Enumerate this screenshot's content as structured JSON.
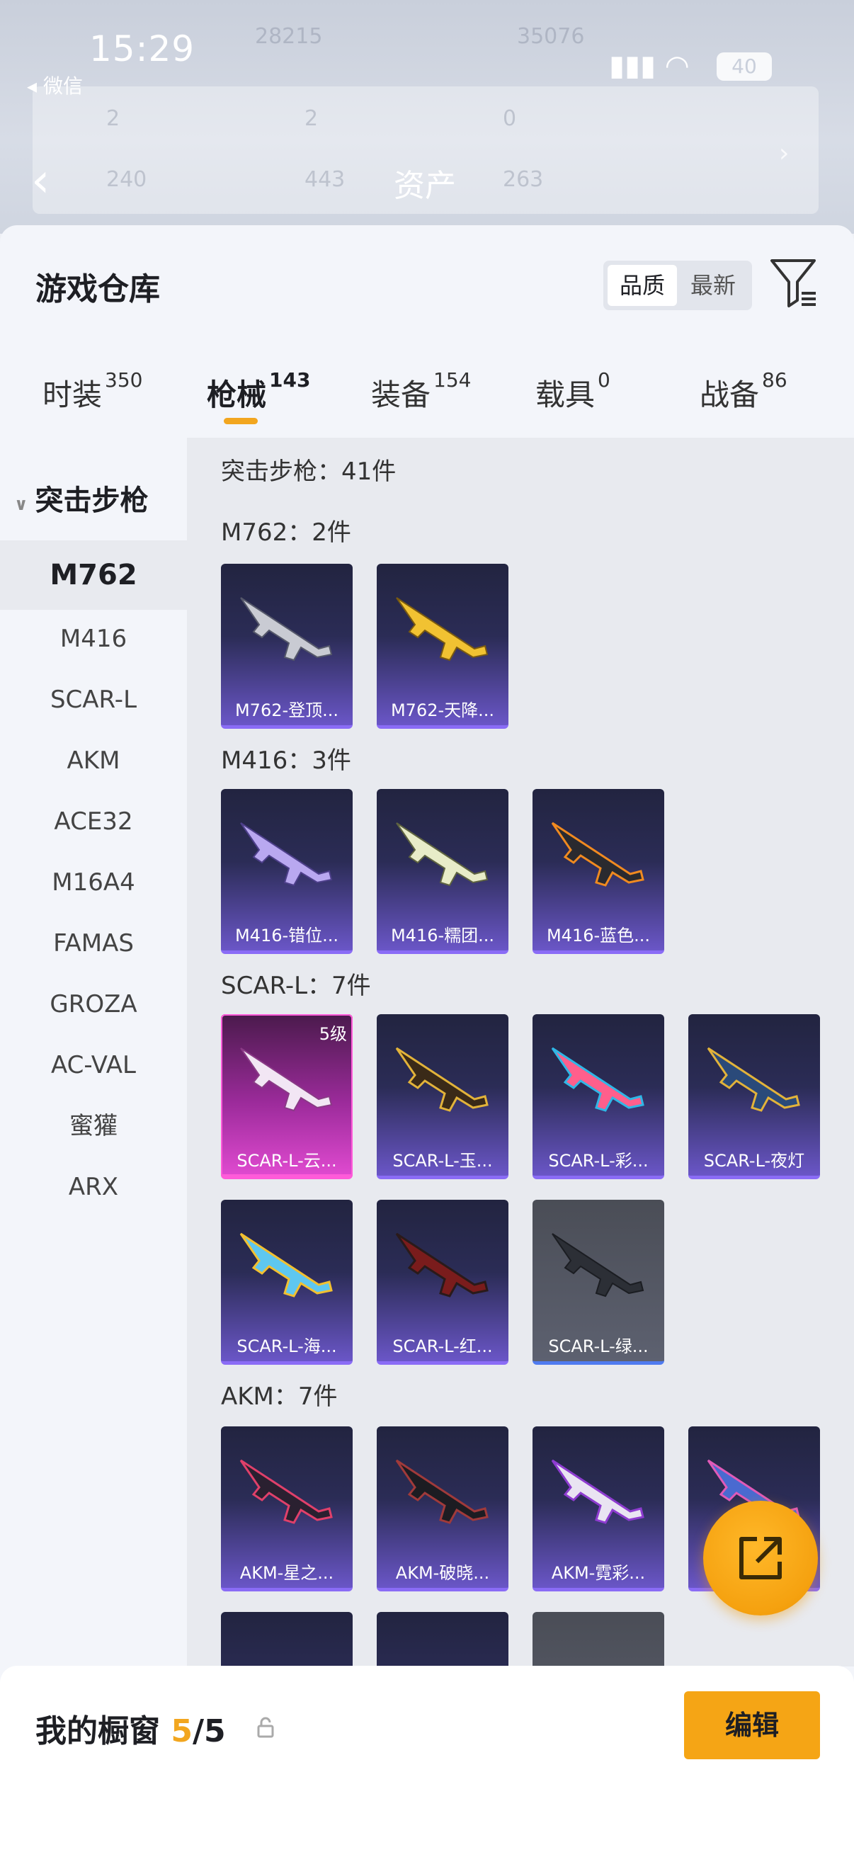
{
  "status": {
    "time": "15:29",
    "battery": "40",
    "back_app": "◂ 微信"
  },
  "nav": {
    "title": "资产",
    "back_icon": "chevron-left-icon"
  },
  "background_stats": [
    "28215",
    "35076",
    "2",
    "2",
    "0",
    "240",
    "443",
    "263"
  ],
  "sheet": {
    "title": "游戏仓库",
    "sort_options": [
      "品质",
      "最新"
    ],
    "sort_active": "品质"
  },
  "tabs": [
    {
      "label": "时装",
      "count": "350"
    },
    {
      "label": "枪械",
      "count": "143"
    },
    {
      "label": "装备",
      "count": "154"
    },
    {
      "label": "载具",
      "count": "0"
    },
    {
      "label": "战备",
      "count": "86"
    }
  ],
  "side": {
    "group": "突击步枪",
    "items": [
      "M762",
      "M416",
      "SCAR-L",
      "AKM",
      "ACE32",
      "M16A4",
      "FAMAS",
      "GROZA",
      "AC-VAL",
      "蜜獾",
      "ARX"
    ]
  },
  "list": {
    "total": "突击步枪：41件",
    "groups": [
      {
        "label": "M762：2件",
        "items": [
          "M762-登顶...",
          "M762-天降..."
        ]
      },
      {
        "label": "M416：3件",
        "items": [
          "M416-错位...",
          "M416-糯团...",
          "M416-蓝色..."
        ]
      },
      {
        "label": "SCAR-L：7件",
        "items": [
          "SCAR-L-云...",
          "SCAR-L-玉...",
          "SCAR-L-彩...",
          "SCAR-L-夜灯",
          "SCAR-L-海...",
          "SCAR-L-红...",
          "SCAR-L-绿..."
        ],
        "badge": "5级"
      },
      {
        "label": "AKM：7件",
        "items": [
          "AKM-星之...",
          "AKM-破晓...",
          "AKM-霓彩..."
        ]
      }
    ]
  },
  "bottom": {
    "title": "我的橱窗",
    "count_current": "5",
    "count_total": "/5",
    "edit_label": "编辑"
  },
  "colors": {
    "accent": "#f5a515",
    "card_purple": "#6a56c7",
    "card_pink": "#e04ad0"
  }
}
